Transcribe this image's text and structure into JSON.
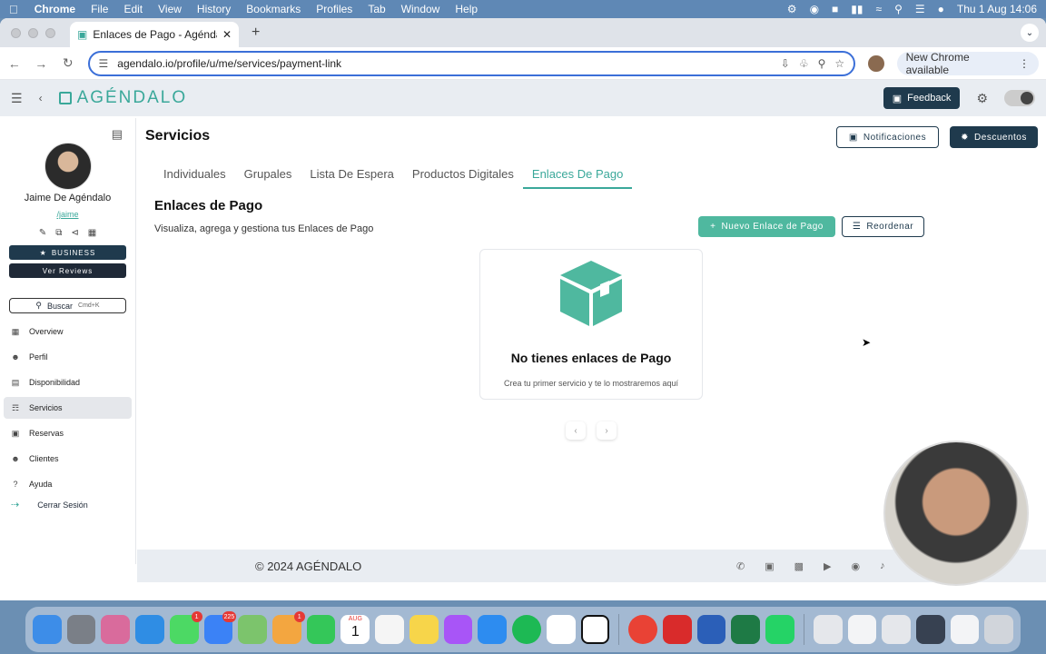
{
  "menubar": {
    "app": "Chrome",
    "items": [
      "File",
      "Edit",
      "View",
      "History",
      "Bookmarks",
      "Profiles",
      "Tab",
      "Window",
      "Help"
    ],
    "datetime": "Thu 1 Aug  14:06"
  },
  "browser": {
    "tab_title": "Enlaces de Pago - Agéndalo /",
    "url": "agendalo.io/profile/u/me/services/payment-link",
    "new_chrome": "New Chrome available"
  },
  "app": {
    "logo": "AGÉNDALO",
    "feedback": "Feedback"
  },
  "sidebar": {
    "name": "Jaime De Agéndalo",
    "username": "/jaime",
    "business": "BUSINESS",
    "reviews": "Ver Reviews",
    "search": "Buscar",
    "search_key": "Cmd+K",
    "items": [
      {
        "label": "Overview",
        "icon": "grid-icon"
      },
      {
        "label": "Perfil",
        "icon": "user-icon"
      },
      {
        "label": "Disponibilidad",
        "icon": "clipboard-icon"
      },
      {
        "label": "Servicios",
        "icon": "layers-icon"
      },
      {
        "label": "Reservas",
        "icon": "calendar-icon"
      },
      {
        "label": "Clientes",
        "icon": "users-icon"
      },
      {
        "label": "Ayuda",
        "icon": "help-icon"
      }
    ],
    "logout": "Cerrar Sesión"
  },
  "main": {
    "title": "Servicios",
    "notificaciones": "Notificaciones",
    "descuentos": "Descuentos",
    "tabs": [
      "Individuales",
      "Grupales",
      "Lista De Espera",
      "Productos Digitales",
      "Enlaces De Pago"
    ],
    "active_tab": "Enlaces De Pago",
    "section_title": "Enlaces de Pago",
    "section_desc": "Visualiza, agrega y gestiona tus Enlaces de Pago",
    "new_button": "Nuevo Enlace de Pago",
    "reorder_button": "Reordenar",
    "empty_title": "No tienes enlaces de Pago",
    "empty_sub": "Crea tu primer servicio y te lo mostraremos aquí"
  },
  "footer": {
    "copyright": "© 2024 AGÉNDALO"
  },
  "colors": {
    "accent": "#3aa89a",
    "dark": "#1f3a4d"
  },
  "dock": {
    "mail_badge": "225",
    "messages_badge": "1",
    "photos_badge": "1",
    "calendar_month": "AUG",
    "calendar_day": "1"
  }
}
